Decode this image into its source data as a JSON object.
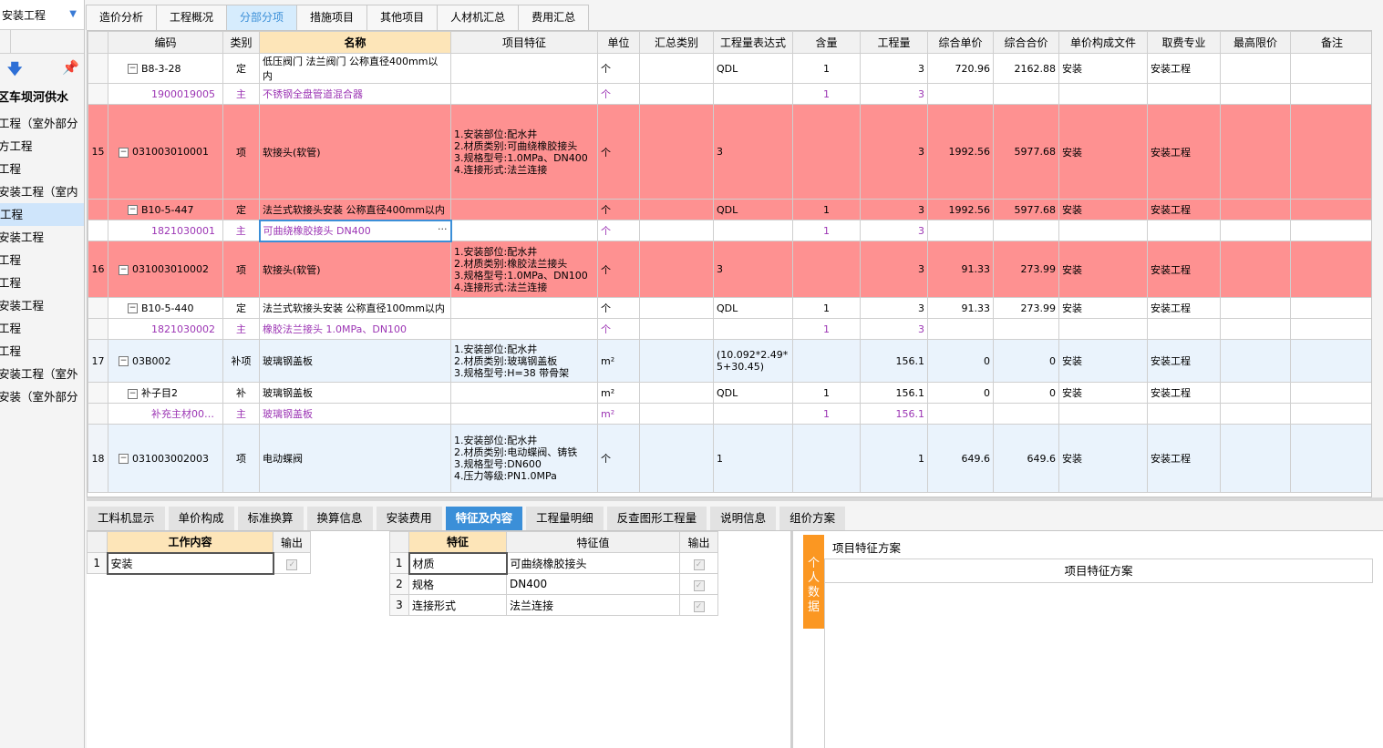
{
  "sidebar": {
    "dropdown_label": "安装工程",
    "project_name": "区车坝河供水",
    "items": [
      {
        "label": "工程（室外部分",
        "active": false
      },
      {
        "label": "方工程",
        "active": false
      },
      {
        "label": "工程",
        "active": false
      },
      {
        "label": "安装工程（室内",
        "active": false
      },
      {
        "label": "工程",
        "active": true
      },
      {
        "label": "安装工程",
        "active": false
      },
      {
        "label": "工程",
        "active": false
      },
      {
        "label": "工程",
        "active": false
      },
      {
        "label": "安装工程",
        "active": false
      },
      {
        "label": "工程",
        "active": false
      },
      {
        "label": "工程",
        "active": false
      },
      {
        "label": "安装工程（室外",
        "active": false
      },
      {
        "label": "安装（室外部分",
        "active": false
      }
    ]
  },
  "tabs": [
    "造价分析",
    "工程概况",
    "分部分项",
    "措施项目",
    "其他项目",
    "人材机汇总",
    "费用汇总"
  ],
  "active_tab": "分部分项",
  "grid": {
    "headers": [
      "",
      "编码",
      "类别",
      "名称",
      "项目特征",
      "单位",
      "汇总类别",
      "工程量表达式",
      "含量",
      "工程量",
      "综合单价",
      "综合合价",
      "单价构成文件",
      "取费专业",
      "最高限价",
      "备注"
    ],
    "rows": [
      {
        "idx": "",
        "code": "B8-3-28",
        "kind": "定",
        "name": "低压阀门 法兰阀门 公称直径400mm以内",
        "feature": "",
        "unit": "个",
        "sum": "",
        "expr": "QDL",
        "content": "1",
        "qty": "3",
        "price": "720.96",
        "total": "2162.88",
        "file": "安装",
        "major": "安装工程",
        "limit": "",
        "note": "",
        "style": "normal",
        "level": 2,
        "box": "−"
      },
      {
        "idx": "",
        "code": "1900019005",
        "kind": "主",
        "name": "不锈钢全盘管道混合器",
        "feature": "",
        "unit": "个",
        "sum": "",
        "expr": "",
        "content": "1",
        "qty": "3",
        "price": "",
        "total": "",
        "file": "",
        "major": "",
        "limit": "",
        "note": "",
        "style": "main",
        "level": 4,
        "box": ""
      },
      {
        "idx": "15",
        "code": "031003010001",
        "kind": "项",
        "name": "软接头(软管)",
        "feature": "1.安装部位:配水井\n2.材质类别:可曲绕橡胶接头\n3.规格型号:1.0MPa、DN400\n4.连接形式:法兰连接",
        "unit": "个",
        "sum": "",
        "expr": "3",
        "content": "",
        "qty": "3",
        "price": "1992.56",
        "total": "5977.68",
        "file": "安装",
        "major": "安装工程",
        "limit": "",
        "note": "",
        "style": "item",
        "level": 1,
        "box": "−"
      },
      {
        "idx": "",
        "code": "B10-5-447",
        "kind": "定",
        "name": "法兰式软接头安装 公称直径400mm以内",
        "feature": "",
        "unit": "个",
        "sum": "",
        "expr": "QDL",
        "content": "1",
        "qty": "3",
        "price": "1992.56",
        "total": "5977.68",
        "file": "安装",
        "major": "安装工程",
        "limit": "",
        "note": "",
        "style": "item",
        "level": 2,
        "box": "−"
      },
      {
        "idx": "",
        "code": "1821030001",
        "kind": "主",
        "name": "可曲绕橡胶接头 DN400",
        "feature": "",
        "unit": "个",
        "sum": "",
        "expr": "",
        "content": "1",
        "qty": "3",
        "price": "",
        "total": "",
        "file": "",
        "major": "",
        "limit": "",
        "note": "",
        "style": "main-sel",
        "level": 4,
        "box": ""
      },
      {
        "idx": "16",
        "code": "031003010002",
        "kind": "项",
        "name": "软接头(软管)",
        "feature": "1.安装部位:配水井\n2.材质类别:橡胶法兰接头\n3.规格型号:1.0MPa、DN100\n4.连接形式:法兰连接",
        "unit": "个",
        "sum": "",
        "expr": "3",
        "content": "",
        "qty": "3",
        "price": "91.33",
        "total": "273.99",
        "file": "安装",
        "major": "安装工程",
        "limit": "",
        "note": "",
        "style": "item",
        "level": 1,
        "box": "−"
      },
      {
        "idx": "",
        "code": "B10-5-440",
        "kind": "定",
        "name": "法兰式软接头安装 公称直径100mm以内",
        "feature": "",
        "unit": "个",
        "sum": "",
        "expr": "QDL",
        "content": "1",
        "qty": "3",
        "price": "91.33",
        "total": "273.99",
        "file": "安装",
        "major": "安装工程",
        "limit": "",
        "note": "",
        "style": "normal",
        "level": 2,
        "box": "−"
      },
      {
        "idx": "",
        "code": "1821030002",
        "kind": "主",
        "name": "橡胶法兰接头 1.0MPa、DN100",
        "feature": "",
        "unit": "个",
        "sum": "",
        "expr": "",
        "content": "1",
        "qty": "3",
        "price": "",
        "total": "",
        "file": "",
        "major": "",
        "limit": "",
        "note": "",
        "style": "main",
        "level": 4,
        "box": ""
      },
      {
        "idx": "17",
        "code": "03B002",
        "kind": "补项",
        "name": "玻璃钢盖板",
        "feature": "1.安装部位:配水井\n2.材质类别:玻璃钢盖板\n3.规格型号:H=38 带骨架",
        "unit": "m²",
        "sum": "",
        "expr": "(10.092*2.49*\n5+30.45)",
        "content": "",
        "qty": "156.1",
        "price": "0",
        "total": "0",
        "file": "安装",
        "major": "安装工程",
        "limit": "",
        "note": "",
        "style": "blue",
        "level": 1,
        "box": "−"
      },
      {
        "idx": "",
        "code": "补子目2",
        "kind": "补",
        "name": "玻璃钢盖板",
        "feature": "",
        "unit": "m²",
        "sum": "",
        "expr": "QDL",
        "content": "1",
        "qty": "156.1",
        "price": "0",
        "total": "0",
        "file": "安装",
        "major": "安装工程",
        "limit": "",
        "note": "",
        "style": "normal",
        "level": 2,
        "box": "−"
      },
      {
        "idx": "",
        "code": "补充主材00…",
        "kind": "主",
        "name": "玻璃钢盖板",
        "feature": "",
        "unit": "m²",
        "sum": "",
        "expr": "",
        "content": "1",
        "qty": "156.1",
        "price": "",
        "total": "",
        "file": "",
        "major": "",
        "limit": "",
        "note": "",
        "style": "main",
        "level": 4,
        "box": ""
      },
      {
        "idx": "18",
        "code": "031003002003",
        "kind": "项",
        "name": "电动蝶阀",
        "feature": "1.安装部位:配水井\n2.材质类别:电动蝶阀、铸铁\n3.规格型号:DN600\n4.压力等级:PN1.0MPa",
        "unit": "个",
        "sum": "",
        "expr": "1",
        "content": "",
        "qty": "1",
        "price": "649.6",
        "total": "649.6",
        "file": "安装",
        "major": "安装工程",
        "limit": "",
        "note": "",
        "style": "blue",
        "level": 1,
        "box": "−"
      }
    ]
  },
  "bottom_tabs": [
    "工料机显示",
    "单价构成",
    "标准换算",
    "换算信息",
    "安装费用",
    "特征及内容",
    "工程量明细",
    "反查图形工程量",
    "说明信息",
    "组价方案"
  ],
  "active_bottom_tab": "特征及内容",
  "work_content": {
    "headers": [
      "",
      "工作内容",
      "输出"
    ],
    "rows": [
      {
        "idx": "1",
        "content": "安装",
        "checked": true
      }
    ]
  },
  "features": {
    "headers": [
      "",
      "特征",
      "特征值",
      "输出"
    ],
    "rows": [
      {
        "idx": "1",
        "feature": "材质",
        "value": "可曲绕橡胶接头",
        "checked": true
      },
      {
        "idx": "2",
        "feature": "规格",
        "value": "DN400",
        "checked": true
      },
      {
        "idx": "3",
        "feature": "连接形式",
        "value": "法兰连接",
        "checked": true
      }
    ]
  },
  "personal_data_label": "个人数据",
  "scheme_title": "项目特征方案",
  "scheme_header": "项目特征方案",
  "colors": {
    "item_row": "#fe9191",
    "main_text": "#9c35b4",
    "accent": "#3b8fd8",
    "orange": "#fb9722",
    "header_highlight": "#fde5b8"
  }
}
